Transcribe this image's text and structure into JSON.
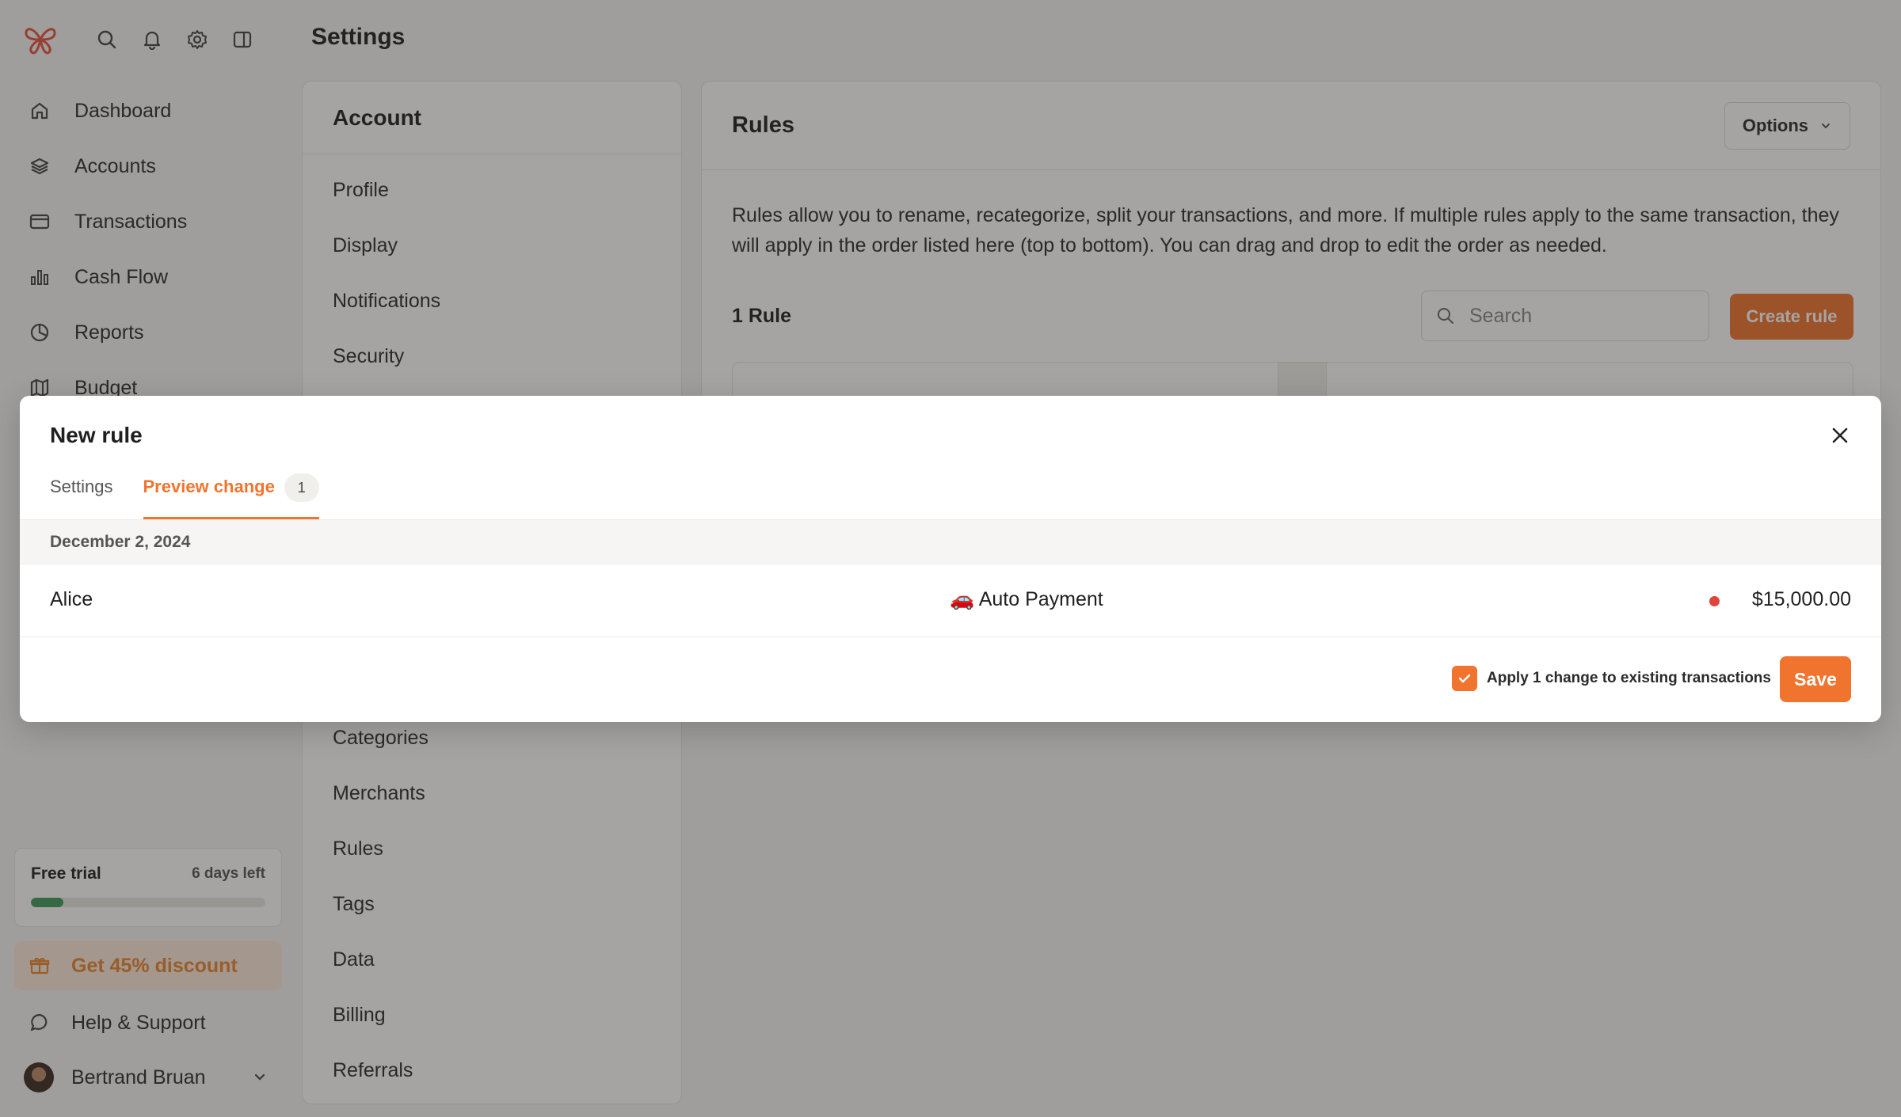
{
  "header": {
    "page_title": "Settings",
    "icons": [
      "search-icon",
      "bell-icon",
      "gear-icon",
      "sidebar-toggle-icon"
    ]
  },
  "sidebar": {
    "items": [
      {
        "label": "Dashboard",
        "icon": "home-icon"
      },
      {
        "label": "Accounts",
        "icon": "layers-icon"
      },
      {
        "label": "Transactions",
        "icon": "card-icon"
      },
      {
        "label": "Cash Flow",
        "icon": "bar-chart-icon"
      },
      {
        "label": "Reports",
        "icon": "pie-chart-icon"
      },
      {
        "label": "Budget",
        "icon": "map-icon"
      }
    ],
    "trial": {
      "title": "Free trial",
      "days_left": "6 days left",
      "progress": 0.14
    },
    "discount_label": "Get 45% discount",
    "help_label": "Help & Support",
    "user_name": "Bertrand Bruan"
  },
  "settings_nav": {
    "header": "Account",
    "items": [
      "Profile",
      "Display",
      "Notifications",
      "Security",
      "Categories",
      "Merchants",
      "Rules",
      "Tags",
      "Data",
      "Billing",
      "Referrals"
    ]
  },
  "rules": {
    "title": "Rules",
    "options_label": "Options",
    "description": "Rules allow you to rename, recategorize, split your transactions, and more. If multiple rules apply to the same transaction, they will apply in the order listed here (top to bottom). You can drag and drop to edit the order as needed.",
    "count_label": "1 Rule",
    "search_placeholder": "Search",
    "create_label": "Create rule"
  },
  "modal": {
    "title": "New rule",
    "tabs": [
      {
        "label": "Settings",
        "active": false
      },
      {
        "label": "Preview change",
        "active": true,
        "badge": "1"
      }
    ],
    "date": "December 2, 2024",
    "transaction": {
      "merchant": "Alice",
      "category": "🚗 Auto Payment",
      "amount": "$15,000.00"
    },
    "apply_label": "Apply 1 change to existing transactions",
    "apply_checked": true,
    "save_label": "Save"
  },
  "colors": {
    "accent": "#f0742e",
    "progress": "#3f9a5c",
    "status_dot": "#e0453c"
  }
}
